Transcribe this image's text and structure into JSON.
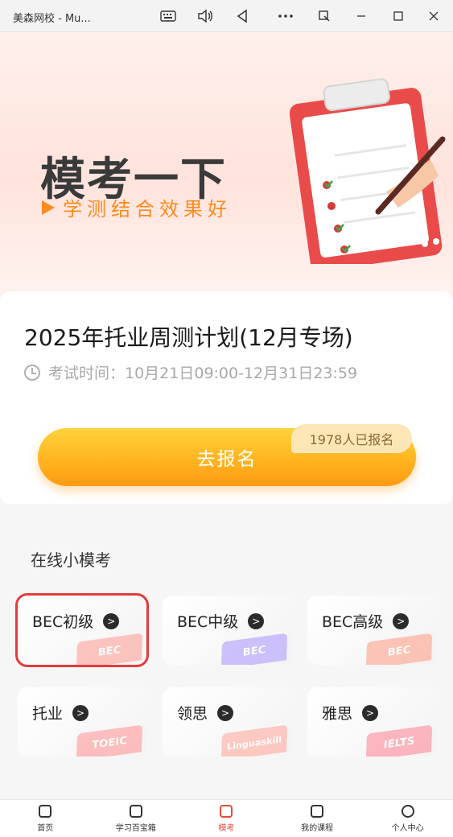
{
  "window": {
    "title": "美森网校 - Mu...",
    "icons": [
      "keyboard-icon",
      "volume-icon",
      "back-icon",
      "more-icon",
      "screen-icon",
      "minimize-icon",
      "maximize-icon",
      "close-icon"
    ]
  },
  "banner": {
    "title": "模考一下",
    "subtitle": "学测结合效果好"
  },
  "plan": {
    "title": "2025年托业周测计划(12月专场)",
    "time_label": "考试时间：10月21日09:00-12月31日23:59",
    "register_label": "去报名",
    "register_count": "1978人已报名"
  },
  "section": {
    "title": "在线小模考"
  },
  "tiles": [
    {
      "label": "BEC初级",
      "deco": "BEC",
      "color": "#ff7a6a"
    },
    {
      "label": "BEC中级",
      "deco": "BEC",
      "color": "#8a6bff"
    },
    {
      "label": "BEC高级",
      "deco": "BEC",
      "color": "#ff7a5a"
    },
    {
      "label": "托业",
      "deco": "TOEIC",
      "color": "#ff6a6a"
    },
    {
      "label": "领思",
      "deco": "Linguaskill",
      "color": "#ff8a7a"
    },
    {
      "label": "雅思",
      "deco": "IELTS",
      "color": "#ff6070"
    }
  ],
  "arrow": ">",
  "nav": [
    {
      "label": "首页",
      "icon": "home-icon"
    },
    {
      "label": "学习百宝箱",
      "icon": "toolbox-icon"
    },
    {
      "label": "模考",
      "icon": "exam-icon",
      "active": true
    },
    {
      "label": "我的课程",
      "icon": "course-icon"
    },
    {
      "label": "个人中心",
      "icon": "profile-icon"
    }
  ],
  "colors": {
    "accent": "#ff9a14",
    "active_nav": "#e44a3b",
    "selection": "#e23c3c"
  }
}
